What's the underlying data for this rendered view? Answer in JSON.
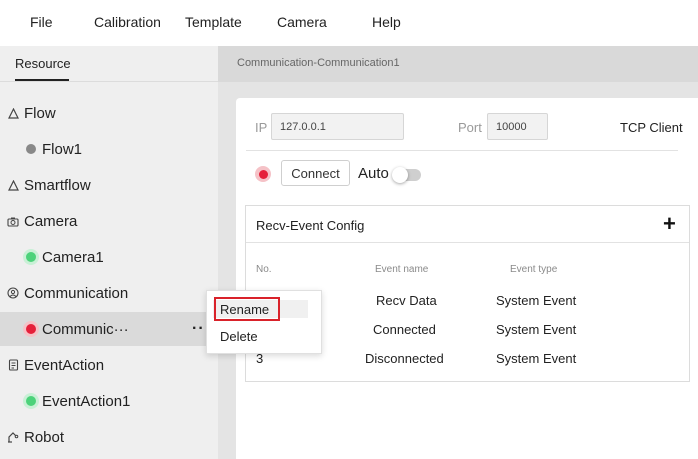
{
  "menubar": {
    "items": [
      "File",
      "Calibration",
      "Template",
      "Camera",
      "Help"
    ]
  },
  "sidebar": {
    "tab_label": "Resource",
    "categories": [
      {
        "label": "Flow",
        "icon": "flow-icon",
        "children": [
          {
            "label": "Flow1",
            "status_color": "#888888"
          }
        ]
      },
      {
        "label": "Smartflow",
        "icon": "flow-icon",
        "children": []
      },
      {
        "label": "Camera",
        "icon": "camera-icon",
        "children": [
          {
            "label": "Camera1",
            "status_color": "#4cd27a"
          }
        ]
      },
      {
        "label": "Communication",
        "icon": "communication-icon",
        "children": [
          {
            "label": "Communic···",
            "status_color": "#e5203a"
          }
        ]
      },
      {
        "label": "EventAction",
        "icon": "event-icon",
        "children": [
          {
            "label": "EventAction1",
            "status_color": "#4cd27a"
          }
        ]
      },
      {
        "label": "Robot",
        "icon": "robot-icon",
        "children": []
      }
    ]
  },
  "context_menu": {
    "items": [
      "Rename",
      "Delete"
    ]
  },
  "content": {
    "header_title": "Communication-Communication1",
    "ip_label": "IP",
    "ip_value": "127.0.0.1",
    "port_label": "Port",
    "port_value": "10000",
    "protocol": "TCP Client",
    "connect_label": "Connect",
    "auto_label": "Auto",
    "auto_enabled": false,
    "connection_status_color": "#e5203a",
    "event_config": {
      "title": "Recv-Event Config",
      "columns": [
        "No.",
        "Event name",
        "Event type"
      ],
      "rows": [
        {
          "no": "",
          "name": "Recv Data",
          "type": "System Event"
        },
        {
          "no": "",
          "name": "Connected",
          "type": "System Event"
        },
        {
          "no": "3",
          "name": "Disconnected",
          "type": "System Event"
        }
      ]
    }
  }
}
